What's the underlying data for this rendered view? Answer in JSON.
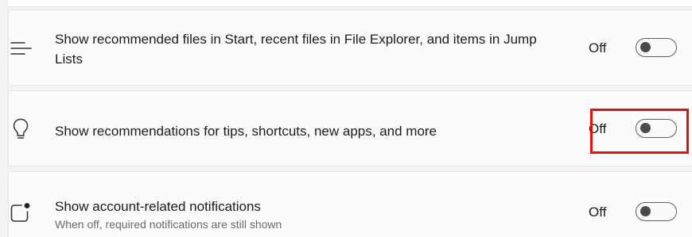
{
  "settings": [
    {
      "title": "Show recommended files in Start, recent files in File Explorer, and items in Jump Lists",
      "subtitle": "",
      "state": "Off",
      "icon": "list-lines-icon"
    },
    {
      "title": "Show recommendations for tips, shortcuts, new apps, and more",
      "subtitle": "",
      "state": "Off",
      "icon": "lightbulb-icon"
    },
    {
      "title": "Show account-related notifications",
      "subtitle": "When off, required notifications are still shown",
      "state": "Off",
      "icon": "notification-badge-icon"
    }
  ],
  "highlight_color": "#e01010",
  "toggle_off_color": "#4b4b4b"
}
